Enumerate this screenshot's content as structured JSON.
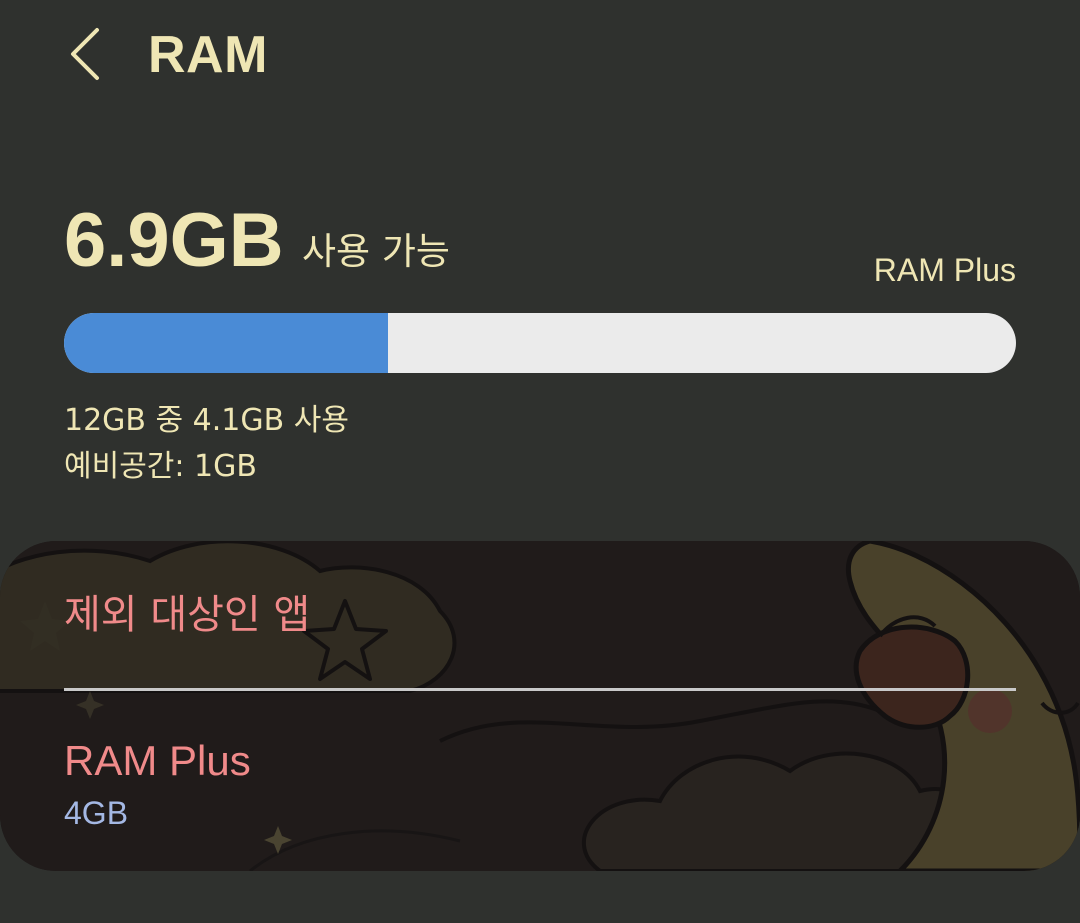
{
  "header": {
    "title": "RAM",
    "back_icon": "chevron-left-icon"
  },
  "summary": {
    "available_value": "6.9GB",
    "available_label": "사용 가능",
    "ram_plus_label": "RAM Plus"
  },
  "usage_bar": {
    "used_fraction": 0.34,
    "used_color": "#4a8bd6",
    "track_color": "#ebebeb"
  },
  "usage": {
    "used_text": "12GB 중 4.1GB 사용",
    "reserved_text": "예비공간: 1GB"
  },
  "settings": {
    "excluded_apps_label": "제외 대상인 앱",
    "ram_plus_title": "RAM Plus",
    "ram_plus_value": "4GB"
  },
  "colors": {
    "background": "#2f312e",
    "text_primary": "#efe6b4",
    "item_title": "#f08a8a",
    "item_subtitle": "#a4b8e4"
  }
}
